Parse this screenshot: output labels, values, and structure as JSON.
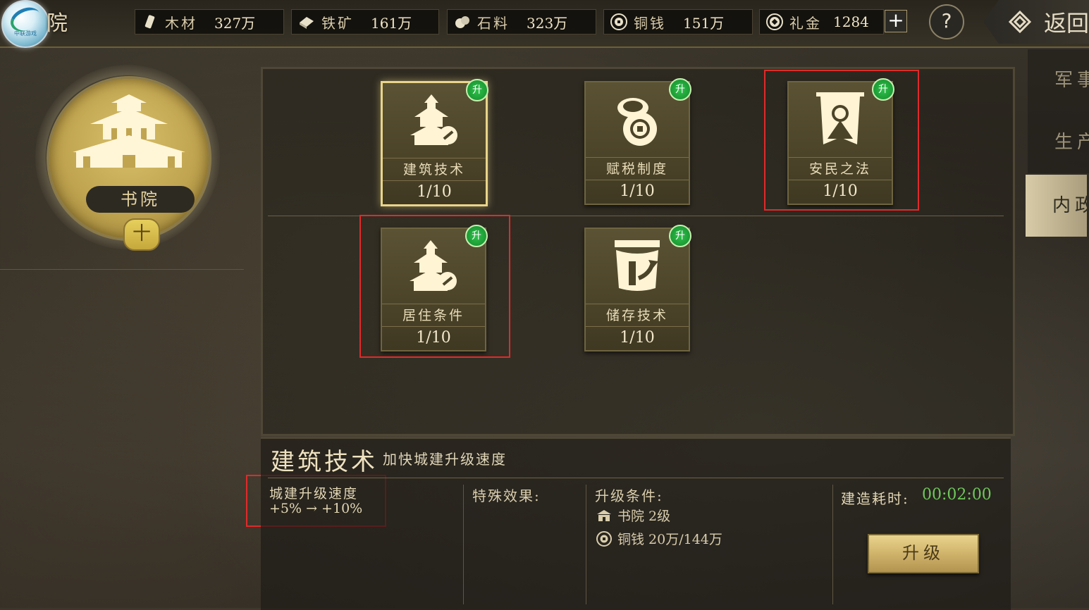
{
  "header": {
    "title": "院",
    "logo_text": "中联游戏",
    "back_label": "返回",
    "help_label": "?",
    "plus_label": "+"
  },
  "resources": [
    {
      "icon": "wood-icon",
      "label": "木材",
      "value": "327万"
    },
    {
      "icon": "iron-ore-icon",
      "label": "铁矿",
      "value": "161万"
    },
    {
      "icon": "stone-icon",
      "label": "石料",
      "value": "323万"
    },
    {
      "icon": "copper-coin-icon",
      "label": "铜钱",
      "value": "151万"
    },
    {
      "icon": "gift-gold-icon",
      "label": "礼金",
      "value": "1284"
    }
  ],
  "building": {
    "name": "书院",
    "level_symbol": "十"
  },
  "side_tabs": [
    {
      "label": "军事",
      "active": false
    },
    {
      "label": "生产",
      "active": false
    },
    {
      "label": "内政",
      "active": true
    }
  ],
  "techs": [
    {
      "name": "建筑技术",
      "level": "1/10",
      "icon": "pagoda-hammer-icon",
      "badge": "升",
      "selected": true
    },
    {
      "name": "赋税制度",
      "level": "1/10",
      "icon": "coins-icon",
      "badge": "升",
      "selected": false
    },
    {
      "name": "安民之法",
      "level": "1/10",
      "icon": "banner-person-icon",
      "badge": "升",
      "selected": false
    },
    {
      "name": "居住条件",
      "level": "1/10",
      "icon": "pagoda-hammer-icon",
      "badge": "升",
      "selected": false
    },
    {
      "name": "储存技术",
      "level": "1/10",
      "icon": "storage-icon",
      "badge": "升",
      "selected": false
    }
  ],
  "detail": {
    "title": "建筑技术",
    "description": "加快城建升级速度",
    "stat_name": "城建升级速度",
    "stat_change": "+5% → +10%",
    "special_label": "特殊效果:",
    "condition_label": "升级条件:",
    "conditions": [
      {
        "icon": "building-icon",
        "text": "书院 2级"
      },
      {
        "icon": "copper-coin-icon",
        "text": "铜钱 20万/144万"
      }
    ],
    "time_label": "建造耗时:",
    "time_value": "00:02:00",
    "upgrade_label": "升级"
  },
  "colors": {
    "highlight": "#e02a2a",
    "badge_green": "#1fa83a",
    "time_green": "#6ec95a",
    "gold": "#d8c06a"
  }
}
